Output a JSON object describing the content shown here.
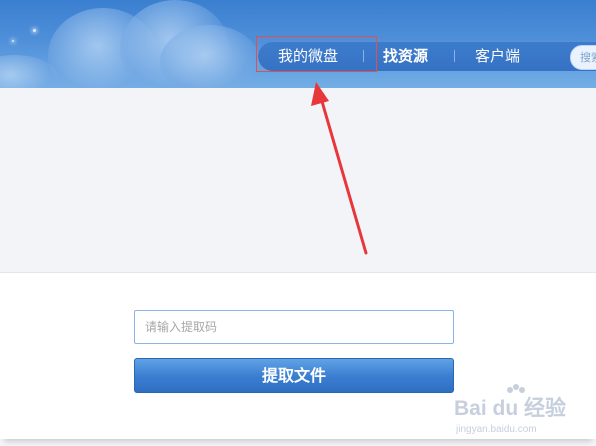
{
  "nav": {
    "items": [
      {
        "label": "我的微盘",
        "active": false
      },
      {
        "label": "找资源",
        "active": true
      },
      {
        "label": "客户端",
        "active": false
      }
    ],
    "search_label": "搜索"
  },
  "extract": {
    "placeholder": "请输入提取码",
    "button_label": "提取文件"
  },
  "annotation": {
    "color": "#e8373a"
  },
  "watermark": {
    "text": "Bai du 经验",
    "url": "jingyan.baidu.com"
  },
  "colors": {
    "header": "#4f8fd9",
    "button": "#3a7dd0"
  }
}
